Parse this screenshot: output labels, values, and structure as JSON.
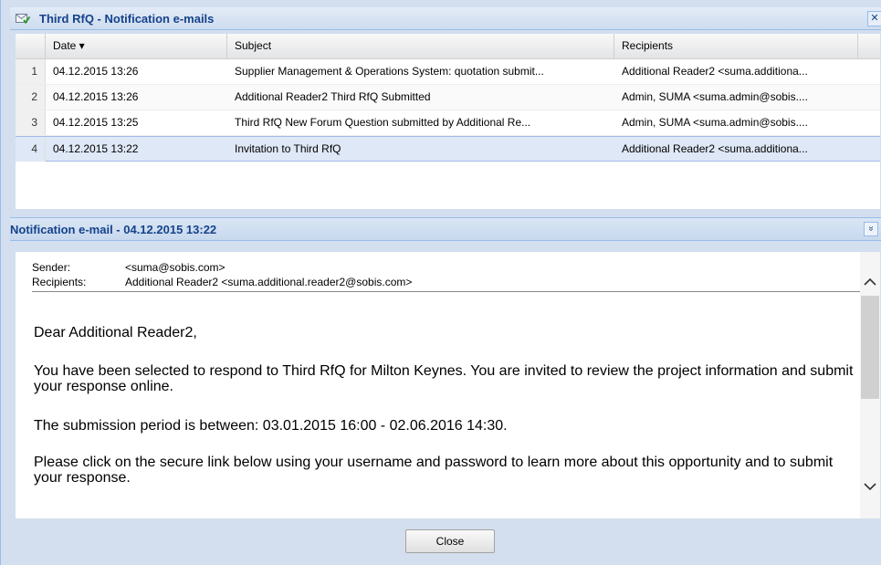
{
  "window": {
    "title": "Third RfQ - Notification e-mails",
    "close_glyph": "✕",
    "icon": "envelope-check-icon"
  },
  "grid": {
    "columns": {
      "date": "Date ▾",
      "subject": "Subject",
      "recipients": "Recipients"
    },
    "rows": [
      {
        "n": "1",
        "date": "04.12.2015 13:26",
        "subject": "Supplier Management & Operations System: quotation submit...",
        "recipients": "Additional Reader2 <suma.additiona..."
      },
      {
        "n": "2",
        "date": "04.12.2015 13:26",
        "subject": "Additional Reader2 Third RfQ Submitted",
        "recipients": "Admin, SUMA <suma.admin@sobis...."
      },
      {
        "n": "3",
        "date": "04.12.2015 13:25",
        "subject": "Third RfQ New Forum Question submitted by Additional Re...",
        "recipients": "Admin, SUMA <suma.admin@sobis...."
      },
      {
        "n": "4",
        "date": "04.12.2015 13:22",
        "subject": "Invitation to Third RfQ",
        "recipients": "Additional Reader2 <suma.additiona..."
      }
    ],
    "selected_row": 4
  },
  "detail": {
    "title": "Notification e-mail - 04.12.2015 13:22",
    "collapse_glyph": "»",
    "sender_label": "Sender:",
    "sender_value": "<suma@sobis.com>",
    "recipients_label": "Recipients:",
    "recipients_value": "Additional Reader2 <suma.additional.reader2@sobis.com>",
    "body": {
      "greeting": "Dear Additional Reader2,",
      "para1": "You have been selected to respond to Third RfQ for Milton Keynes. You are invited to review the project information and submit your response online.",
      "para2": "The submission period is between: 03.01.2015 16:00 - 02.06.2016 14:30.",
      "para3": "Please click on the secure link below using your username and password to learn more about this opportunity and to submit your response."
    }
  },
  "footer": {
    "close_label": "Close"
  }
}
